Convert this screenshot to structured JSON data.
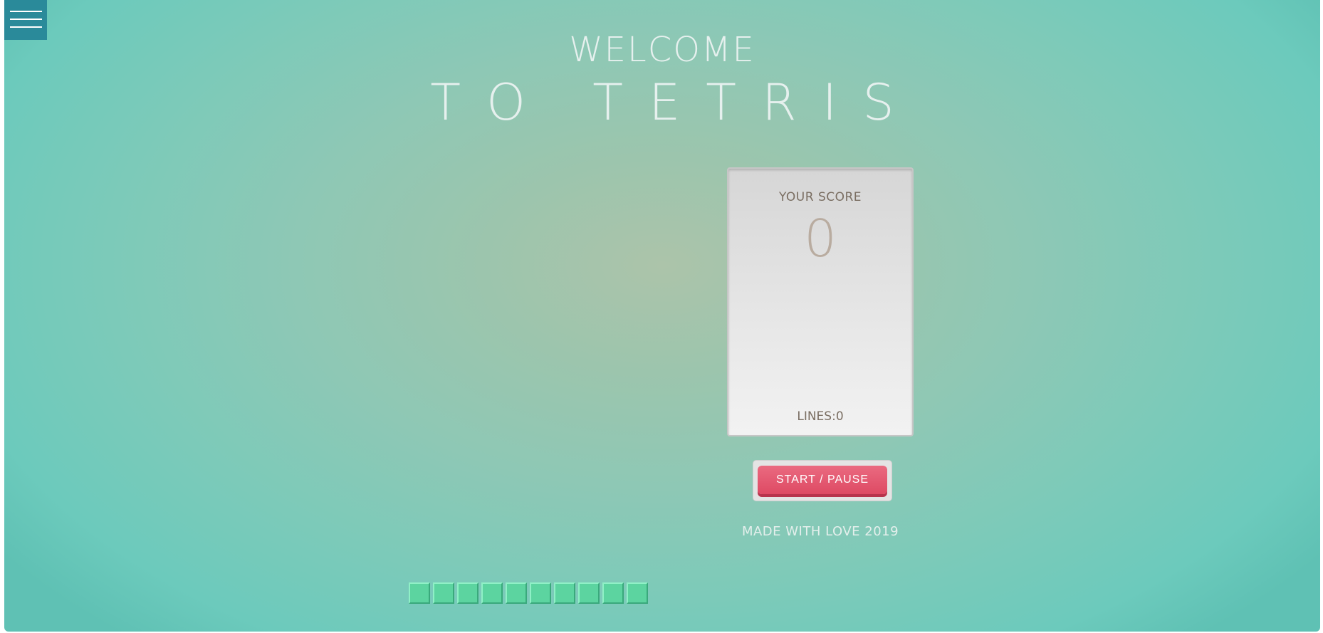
{
  "menu": {
    "icon": "hamburger-menu-icon"
  },
  "header": {
    "welcome": "WELCOME",
    "title": "TO TETRIS"
  },
  "board": {
    "block_color": "#5cd4a0",
    "bottom_row_blocks": 10
  },
  "score_panel": {
    "score_label": "YOUR SCORE",
    "score_value": "0",
    "lines_label": "LINES:0"
  },
  "controls": {
    "start_pause_label": "START / PAUSE",
    "accent_color": "#de4a64"
  },
  "footer": {
    "text": "MADE WITH LOVE 2019"
  }
}
